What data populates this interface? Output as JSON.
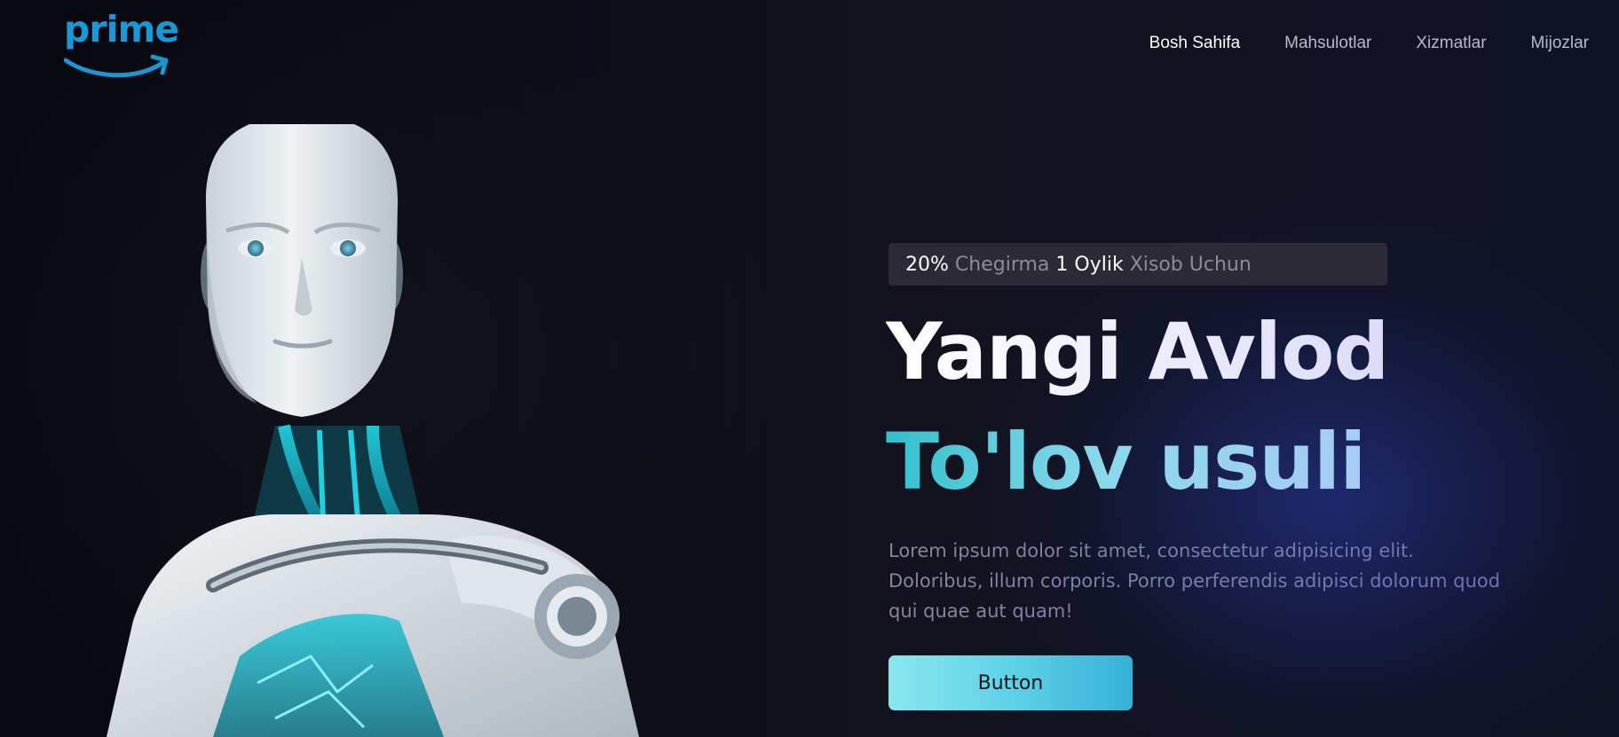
{
  "brand": {
    "logo_text": "prime",
    "logo_color": "#1a98d5"
  },
  "nav": {
    "items": [
      {
        "label": "Bosh Sahifa",
        "active": true
      },
      {
        "label": "Mahsulotlar",
        "active": false
      },
      {
        "label": "Xizmatlar",
        "active": false
      },
      {
        "label": "Mijozlar",
        "active": false
      }
    ]
  },
  "hero": {
    "promo": {
      "discount": "20%",
      "word1": "Chegirma",
      "period": "1 Oylik",
      "word2": "Xisob Uchun"
    },
    "headline": "Yangi Avlod",
    "subheadline": "To'lov usuli",
    "description": "Lorem ipsum dolor sit amet, consectetur adipisicing elit. Doloribus, illum corporis. Porro perferendis adipisci dolorum quod qui quae aut quam!",
    "button_label": "Button",
    "image": "robot-image"
  },
  "colors": {
    "accent_cyan": "#5ed2e6",
    "background": "#0b0b14",
    "glow": "#2838aa"
  }
}
